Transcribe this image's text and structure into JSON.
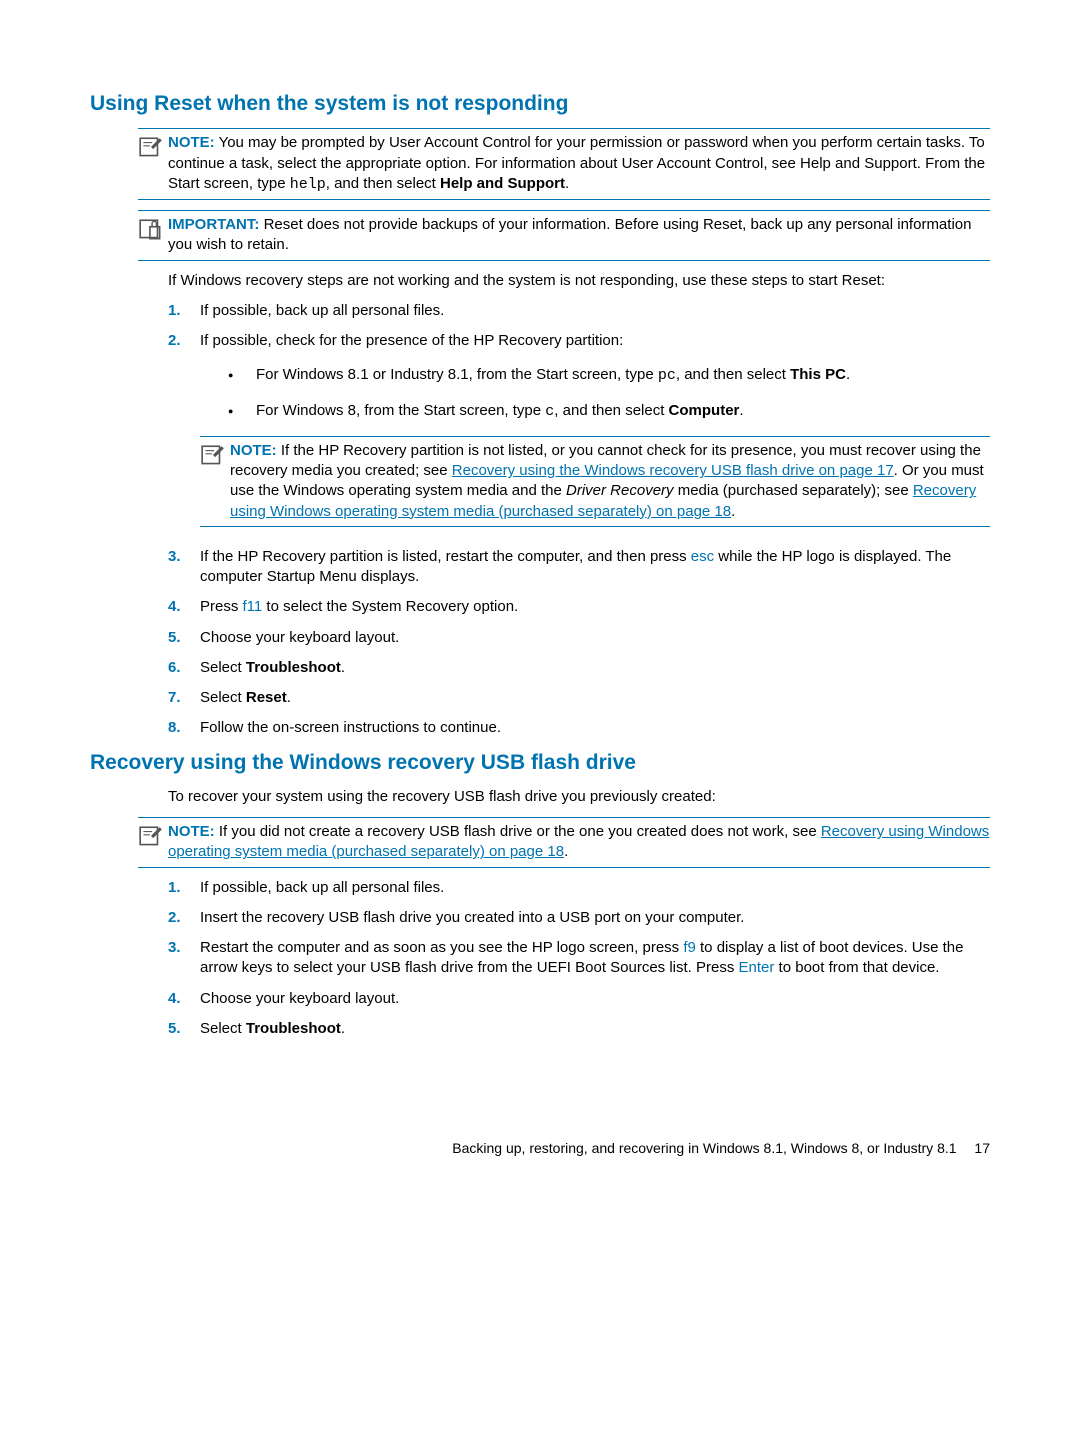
{
  "section1": {
    "heading": "Using Reset when the system is not responding",
    "note1": {
      "label": "NOTE:",
      "text_a": "You may be prompted by User Account Control for your permission or password when you perform certain tasks. To continue a task, select the appropriate option. For information about User Account Control, see Help and Support. From the Start screen, type ",
      "code": "help",
      "text_b": ", and then select ",
      "bold": "Help and Support",
      "text_c": "."
    },
    "important": {
      "label": "IMPORTANT:",
      "text": "Reset does not provide backups of your information. Before using Reset, back up any personal information you wish to retain."
    },
    "intro": "If Windows recovery steps are not working and the system is not responding, use these steps to start Reset:",
    "steps": {
      "s1": {
        "num": "1.",
        "text": "If possible, back up all personal files."
      },
      "s2": {
        "num": "2.",
        "text": "If possible, check for the presence of the HP Recovery partition:",
        "b1_a": "For Windows 8.1 or Industry 8.1, from the Start screen, type ",
        "b1_code": "pc",
        "b1_b": ", and then select ",
        "b1_bold": "This PC",
        "b1_c": ".",
        "b2_a": "For Windows 8, from the Start screen, type ",
        "b2_code": "c",
        "b2_b": ", and then select ",
        "b2_bold": "Computer",
        "b2_c": ".",
        "note": {
          "label": "NOTE:",
          "t1": "If the HP Recovery partition is not listed, or you cannot check for its presence, you must recover using the recovery media you created; see ",
          "link1": "Recovery using the Windows recovery USB flash drive on page 17",
          "t2": ". Or you must use the Windows operating system media and the ",
          "italic": "Driver Recovery",
          "t3": " media (purchased separately); see ",
          "link2": "Recovery using Windows operating system media (purchased separately) on page 18",
          "t4": "."
        }
      },
      "s3": {
        "num": "3.",
        "t1": "If the HP Recovery partition is listed, restart the computer, and then press ",
        "key": "esc",
        "t2": " while the HP logo is displayed. The computer Startup Menu displays."
      },
      "s4": {
        "num": "4.",
        "t1": "Press ",
        "key": "f11",
        "t2": " to select the System Recovery option."
      },
      "s5": {
        "num": "5.",
        "text": "Choose your keyboard layout."
      },
      "s6": {
        "num": "6.",
        "t1": "Select ",
        "bold": "Troubleshoot",
        "t2": "."
      },
      "s7": {
        "num": "7.",
        "t1": "Select ",
        "bold": "Reset",
        "t2": "."
      },
      "s8": {
        "num": "8.",
        "text": "Follow the on-screen instructions to continue."
      }
    }
  },
  "section2": {
    "heading": "Recovery using the Windows recovery USB flash drive",
    "intro": "To recover your system using the recovery USB flash drive you previously created:",
    "note": {
      "label": "NOTE:",
      "t1": "If you did not create a recovery USB flash drive or the one you created does not work, see ",
      "link": "Recovery using Windows operating system media (purchased separately) on page 18",
      "t2": "."
    },
    "steps": {
      "s1": {
        "num": "1.",
        "text": "If possible, back up all personal files."
      },
      "s2": {
        "num": "2.",
        "text": "Insert the recovery USB flash drive you created into a USB port on your computer."
      },
      "s3": {
        "num": "3.",
        "t1": "Restart the computer and as soon as you see the HP logo screen, press ",
        "key1": "f9",
        "t2": " to display a list of boot devices. Use the arrow keys to select your USB flash drive from the UEFI Boot Sources list. Press ",
        "key2": "Enter",
        "t3": " to boot from that device."
      },
      "s4": {
        "num": "4.",
        "text": "Choose your keyboard layout."
      },
      "s5": {
        "num": "5.",
        "t1": "Select ",
        "bold": "Troubleshoot",
        "t2": "."
      }
    }
  },
  "footer": {
    "text": "Backing up, restoring, and recovering in Windows 8.1, Windows 8, or Industry 8.1",
    "page": "17"
  }
}
